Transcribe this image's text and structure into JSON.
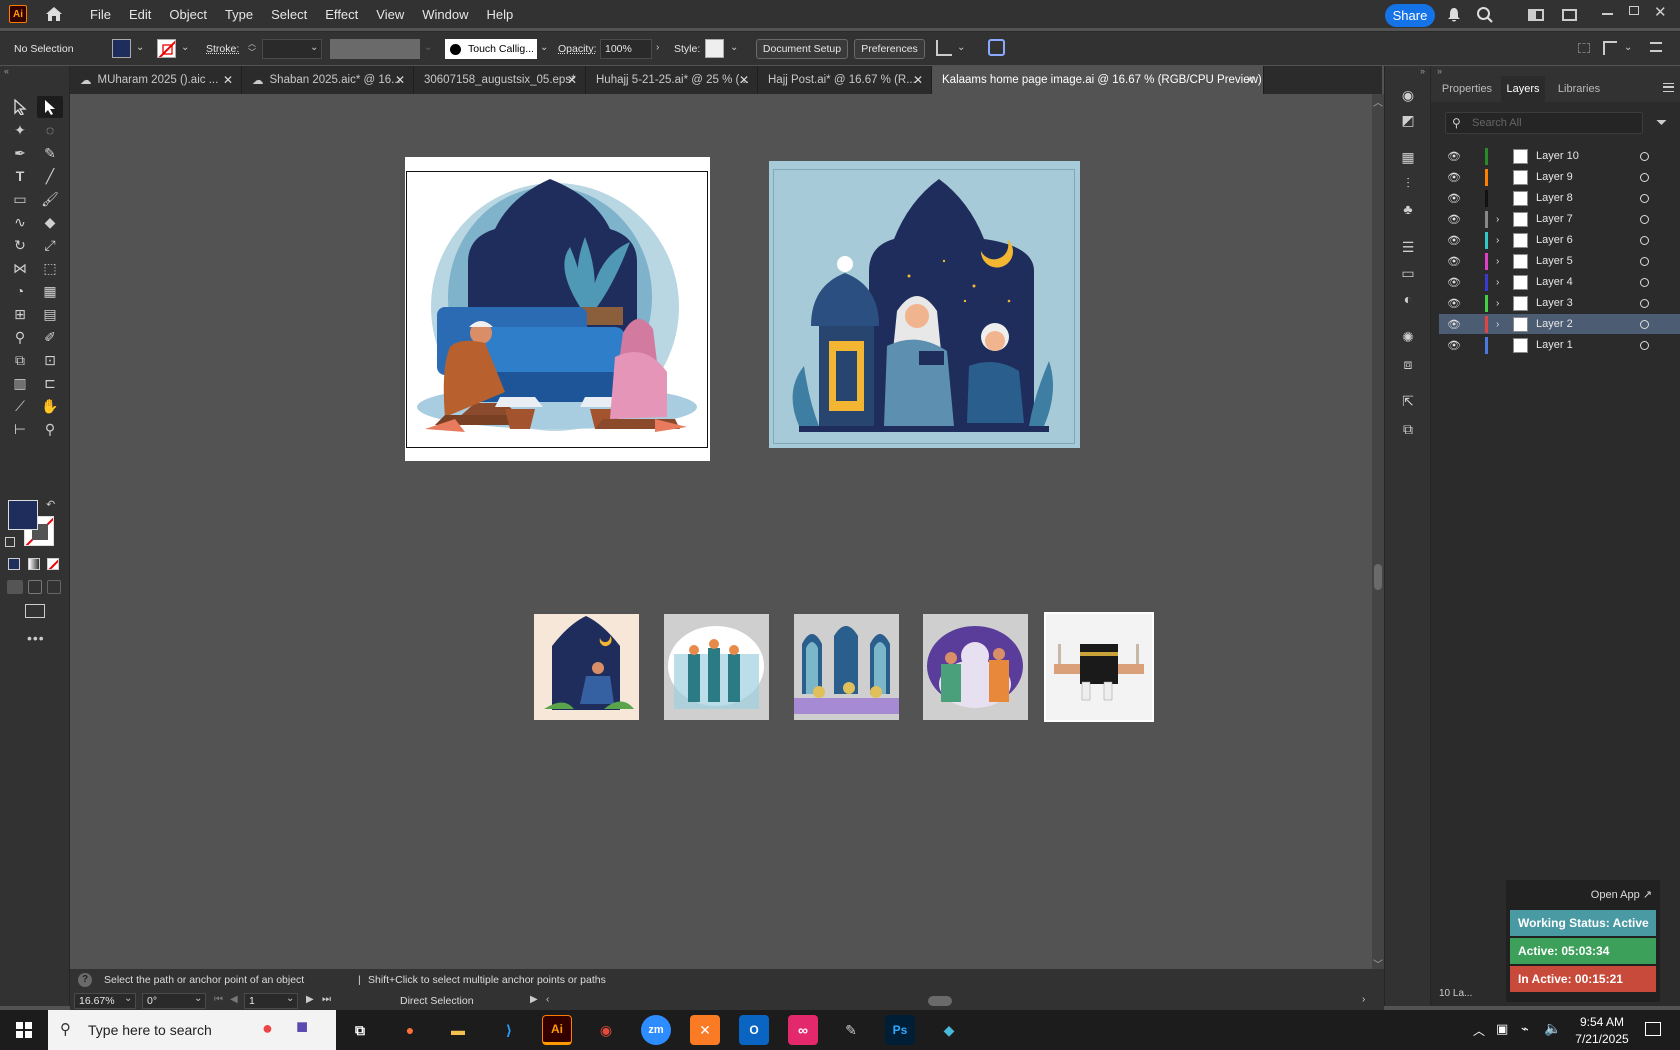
{
  "app": {
    "logo": "Ai"
  },
  "menu": [
    "File",
    "Edit",
    "Object",
    "Type",
    "Select",
    "Effect",
    "View",
    "Window",
    "Help"
  ],
  "share_label": "Share",
  "control": {
    "selection": "No Selection",
    "stroke_label": "Stroke:",
    "brush": "Touch Callig...",
    "opacity_label": "Opacity:",
    "opacity_value": "100%",
    "style_label": "Style:",
    "document_setup": "Document Setup",
    "preferences": "Preferences"
  },
  "tabs": [
    {
      "label": "MUharam 2025 ().aic ..."
    },
    {
      "label": "Shaban 2025.aic* @ 16..."
    },
    {
      "label": "30607158_augustsix_05.eps*"
    },
    {
      "label": "Huhajj 5-21-25.ai* @ 25 % (..."
    },
    {
      "label": "Hajj Post.ai* @ 16.67 % (R..."
    },
    {
      "label": "Kalaams home page image.ai @ 16.67 % (RGB/CPU Preview)"
    }
  ],
  "panel": {
    "tabs": [
      "Properties",
      "Layers",
      "Libraries"
    ],
    "active_tab": "Layers",
    "search_placeholder": "Search All",
    "layers": [
      {
        "name": "Layer 10",
        "color": "#2a8a2a",
        "expandable": false
      },
      {
        "name": "Layer 9",
        "color": "#ff7f00",
        "expandable": false
      },
      {
        "name": "Layer 8",
        "color": "#111111",
        "expandable": false
      },
      {
        "name": "Layer 7",
        "color": "#888888",
        "expandable": true
      },
      {
        "name": "Layer 6",
        "color": "#33c7c7",
        "expandable": true
      },
      {
        "name": "Layer 5",
        "color": "#e040c8",
        "expandable": true
      },
      {
        "name": "Layer 4",
        "color": "#3a3ad0",
        "expandable": true
      },
      {
        "name": "Layer 3",
        "color": "#44d044",
        "expandable": true
      },
      {
        "name": "Layer 2",
        "color": "#e04444",
        "expandable": true,
        "selected": true
      },
      {
        "name": "Layer 1",
        "color": "#4a7adf",
        "expandable": false
      }
    ],
    "layer_count": "10 La..."
  },
  "status": {
    "hint": "Select the path or anchor point of an object",
    "hint2": "Shift+Click to select multiple anchor points or paths",
    "zoom": "16.67%",
    "rotation": "0°",
    "artboard": "1",
    "tool": "Direct Selection"
  },
  "widget": {
    "open_app": "Open App ↗",
    "working_status": "Working Status: Active",
    "active": "Active: 05:03:34",
    "inactive": "In Active: 00:15:21"
  },
  "taskbar": {
    "search_placeholder": "Type here to search",
    "time": "9:54 AM",
    "date": "7/21/2025"
  },
  "colors": {
    "accent": "#1473e6",
    "fill_swatch": "#1f2d5c",
    "status_active": "#4a9aa4",
    "status_green": "#3ca05a",
    "status_red": "#c84a3a"
  }
}
